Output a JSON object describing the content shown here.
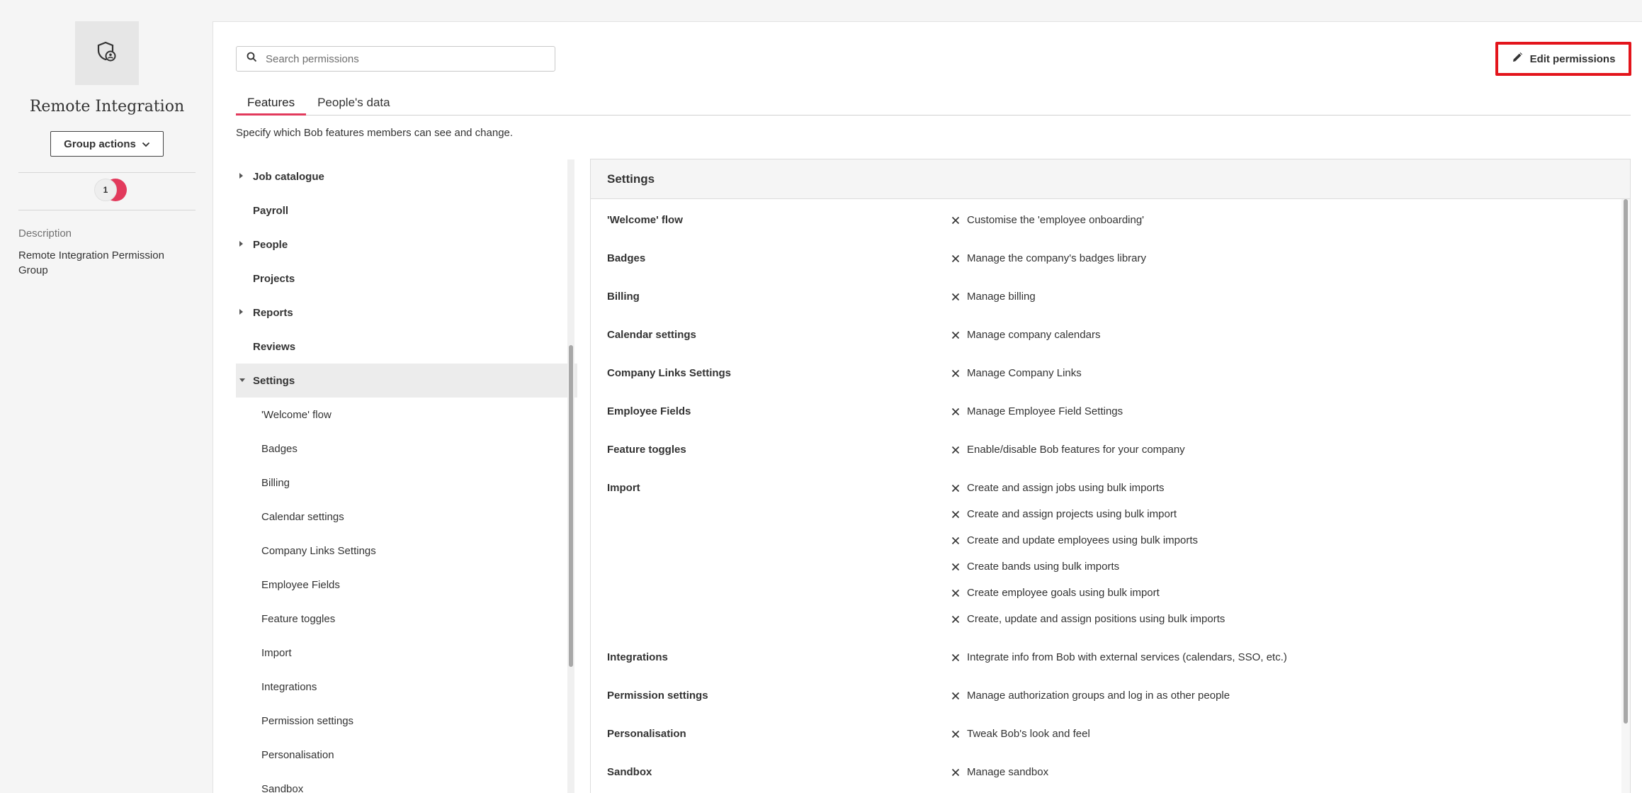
{
  "profile": {
    "icon": "shield-user-icon",
    "name": "Remote Integration",
    "group_actions_label": "Group actions",
    "member_count": "1",
    "description_label": "Description",
    "description_text": "Remote Integration Permission Group"
  },
  "search": {
    "placeholder": "Search permissions",
    "value": ""
  },
  "toolbar": {
    "edit_label": "Edit permissions",
    "highlight_color": "#e3141b"
  },
  "tabs": [
    {
      "label": "Features",
      "active": true
    },
    {
      "label": "People's data",
      "active": false
    }
  ],
  "intro": "Specify which Bob features members can see and change.",
  "accent_color": "#e23a5c",
  "tree": {
    "top_items": [
      {
        "label": "Job catalogue",
        "expandable": true
      },
      {
        "label": "Payroll",
        "expandable": false
      },
      {
        "label": "People",
        "expandable": true
      },
      {
        "label": "Projects",
        "expandable": false
      },
      {
        "label": "Reports",
        "expandable": true
      },
      {
        "label": "Reviews",
        "expandable": false
      },
      {
        "label": "Settings",
        "expandable": true,
        "expanded": true,
        "selected": true
      }
    ],
    "settings_children": [
      "'Welcome' flow",
      "Badges",
      "Billing",
      "Calendar settings",
      "Company Links Settings",
      "Employee Fields",
      "Feature toggles",
      "Import",
      "Integrations",
      "Permission settings",
      "Personalisation",
      "Sandbox"
    ]
  },
  "panel": {
    "title": "Settings",
    "rows": [
      {
        "name": "'Welcome' flow",
        "perms": [
          "Customise the 'employee onboarding'"
        ]
      },
      {
        "name": "Badges",
        "perms": [
          "Manage the company's badges library"
        ]
      },
      {
        "name": "Billing",
        "perms": [
          "Manage billing"
        ]
      },
      {
        "name": "Calendar settings",
        "perms": [
          "Manage company calendars"
        ]
      },
      {
        "name": "Company Links Settings",
        "perms": [
          "Manage Company Links"
        ]
      },
      {
        "name": "Employee Fields",
        "perms": [
          "Manage Employee Field Settings"
        ]
      },
      {
        "name": "Feature toggles",
        "perms": [
          "Enable/disable Bob features for your company"
        ]
      },
      {
        "name": "Import",
        "perms": [
          "Create and assign jobs using bulk imports",
          "Create and assign projects using bulk import",
          "Create and update employees using bulk imports",
          "Create bands using bulk imports",
          "Create employee goals using bulk import",
          "Create, update and assign positions using bulk imports"
        ]
      },
      {
        "name": "Integrations",
        "perms": [
          "Integrate info from Bob with external services (calendars, SSO, etc.)"
        ]
      },
      {
        "name": "Permission settings",
        "perms": [
          "Manage authorization groups and log in as other people"
        ]
      },
      {
        "name": "Personalisation",
        "perms": [
          "Tweak Bob's look and feel"
        ]
      },
      {
        "name": "Sandbox",
        "perms": [
          "Manage sandbox"
        ]
      }
    ]
  }
}
